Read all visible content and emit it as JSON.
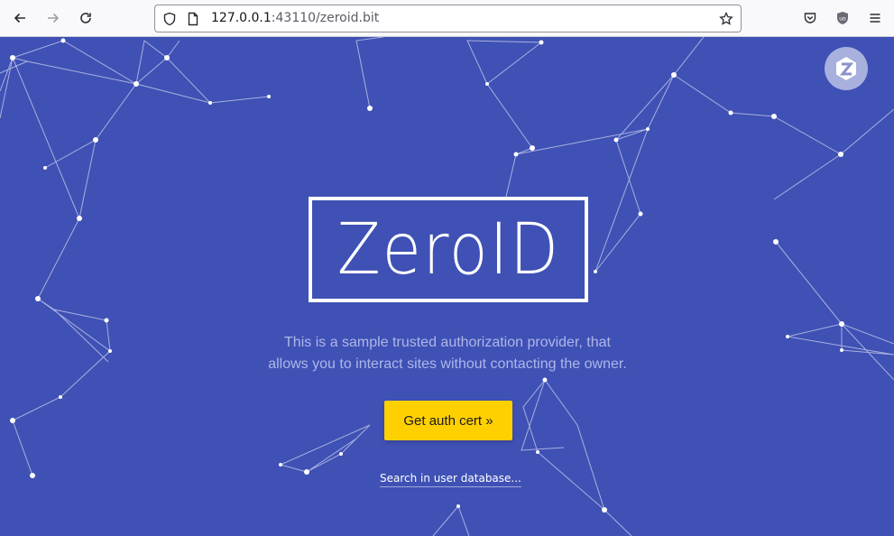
{
  "browser": {
    "url_host": "127.0.0.1",
    "url_rest": ":43110/zeroid.bit"
  },
  "icons": {
    "back": "arrow-left-icon",
    "forward": "arrow-right-icon",
    "reload": "reload-icon",
    "shield": "shield-icon",
    "page": "page-icon",
    "bookmark": "star-icon",
    "pocket": "pocket-icon",
    "extension": "ublock-icon",
    "menu": "hamburger-menu-icon",
    "site_logo": "zeronet-logo-icon"
  },
  "colors": {
    "background": "#3f51b5",
    "accent": "#ffd000",
    "tagline": "#aeb6e8"
  },
  "main": {
    "brand": "ZeroID",
    "tagline_line1": "This is a sample trusted authorization provider, that",
    "tagline_line2": "allows you to interact sites without contacting the owner.",
    "cta_label": "Get auth cert »",
    "search_link": "Search in user database..."
  }
}
